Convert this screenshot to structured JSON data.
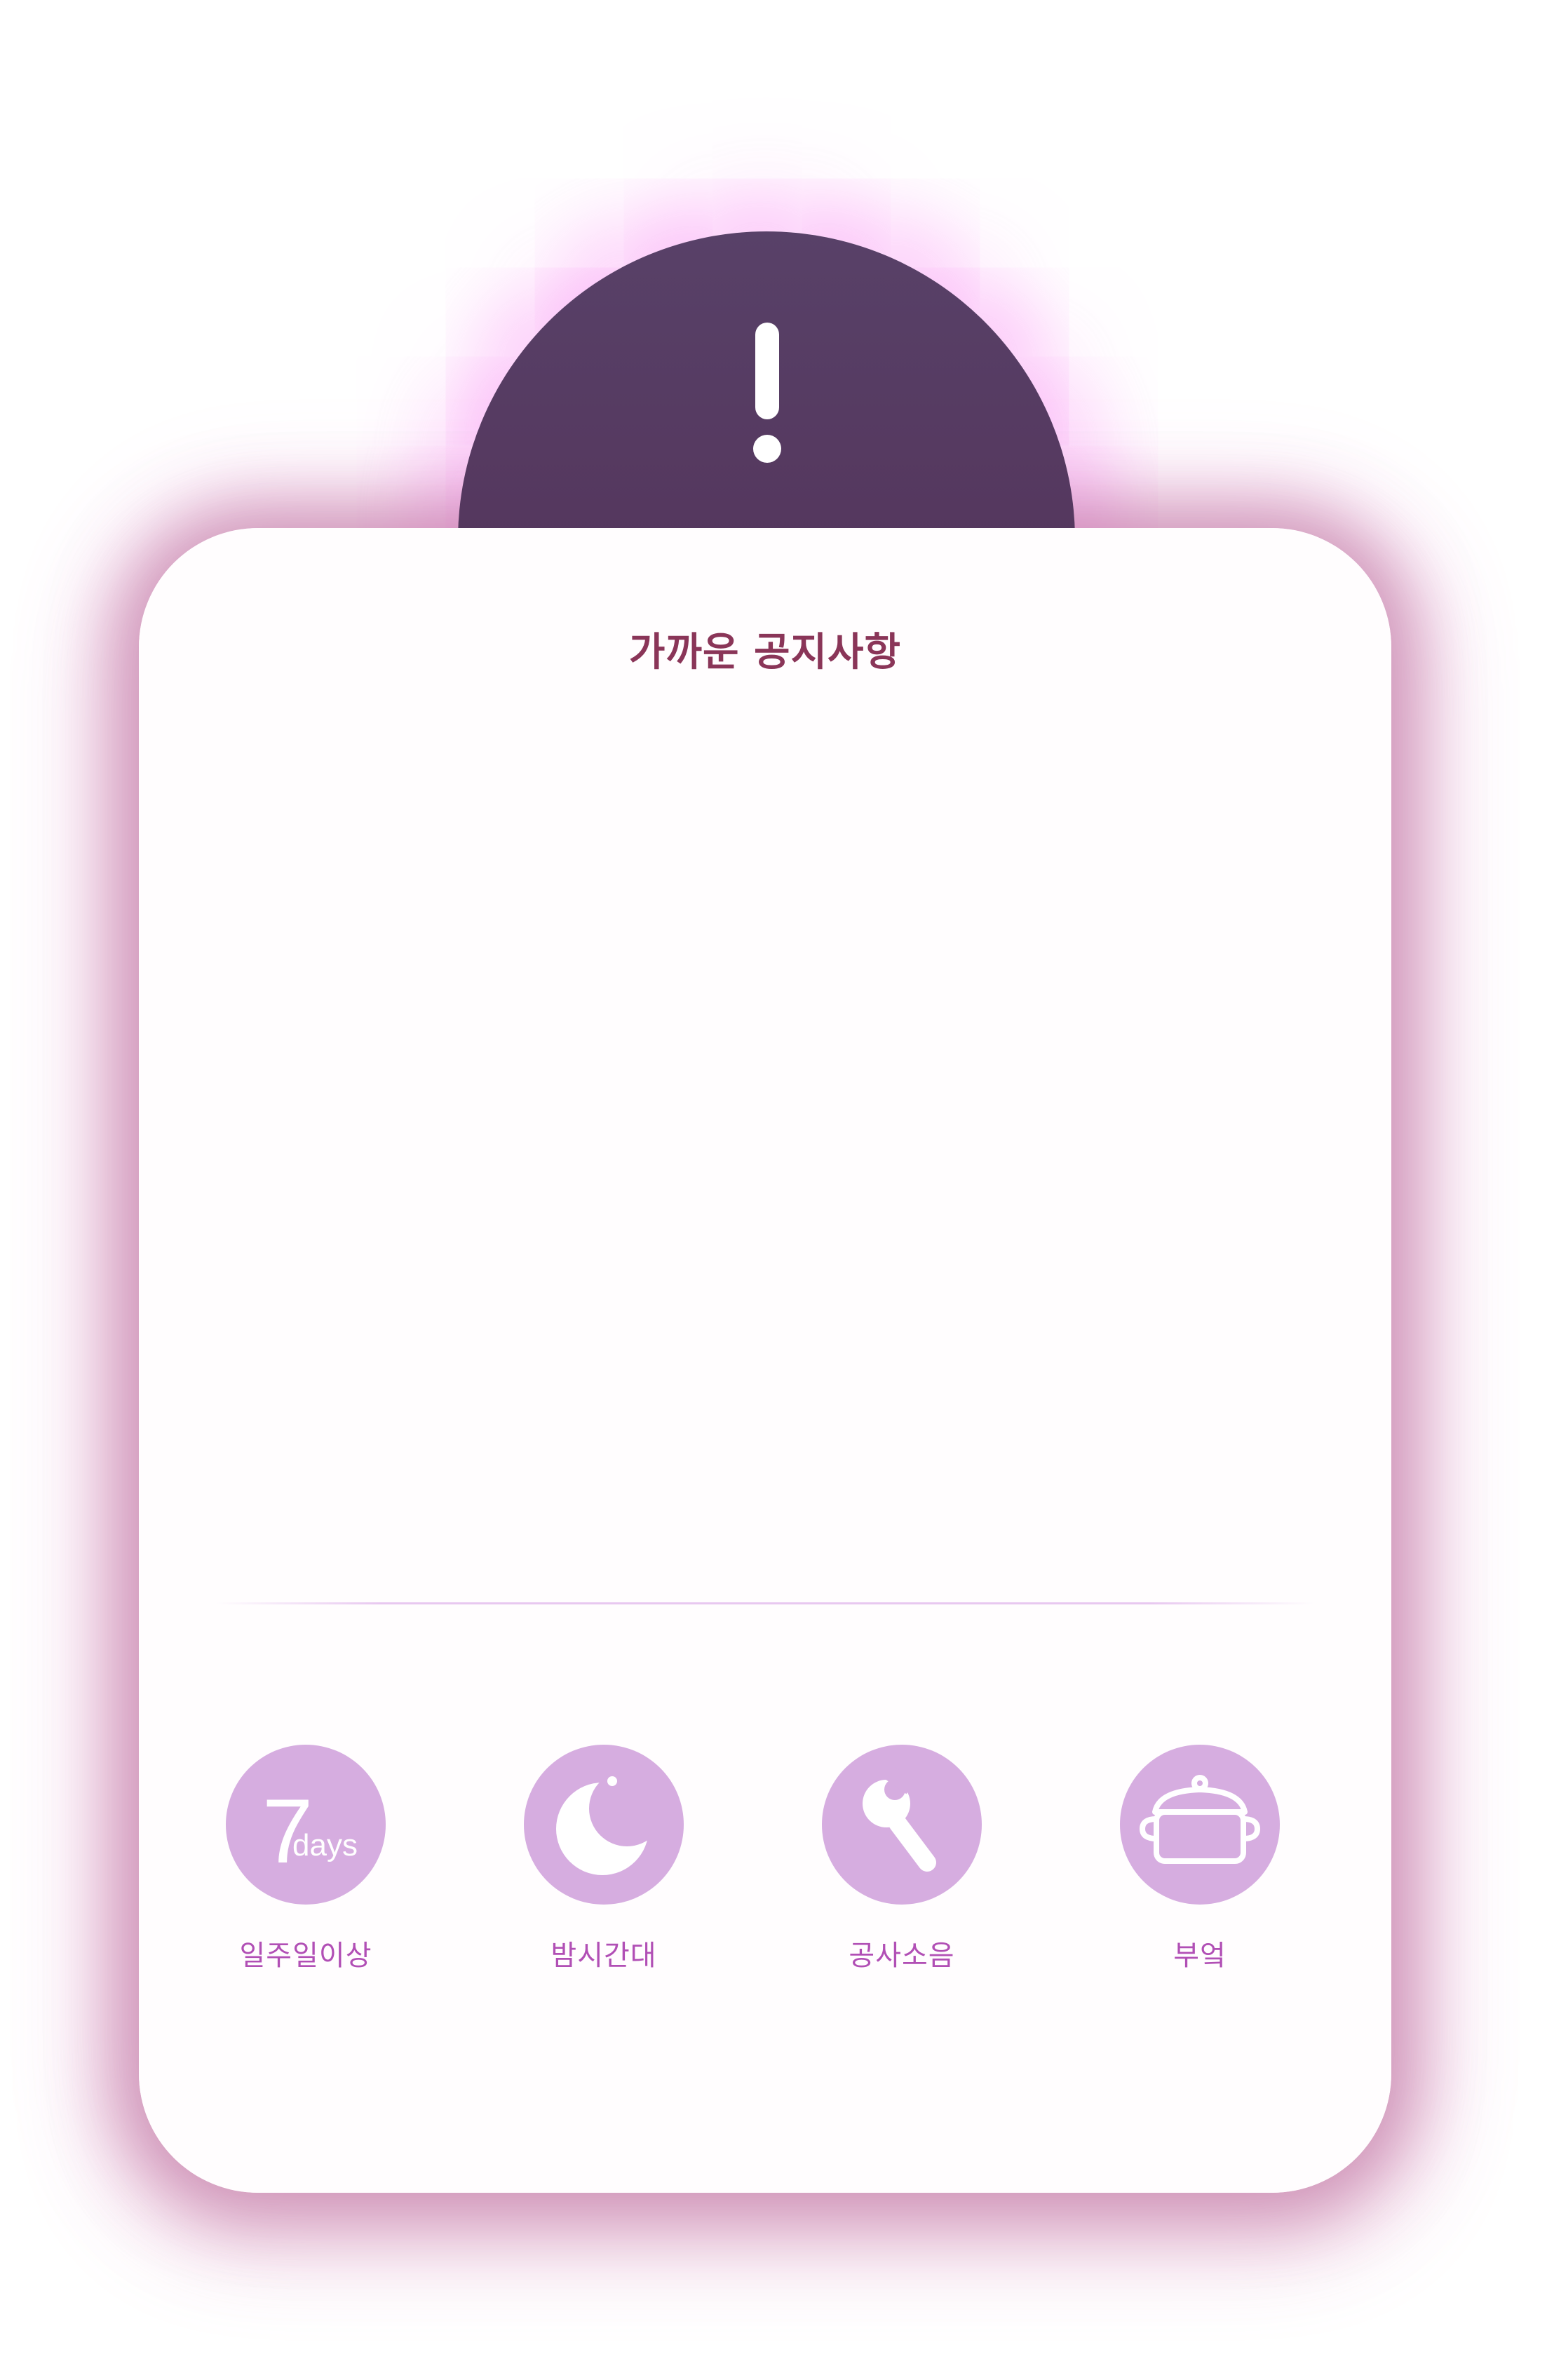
{
  "notice": {
    "title": "가까운 공지사항"
  },
  "categories": [
    {
      "label": "일주일이상",
      "icon": "7-days-icon",
      "icon_number": "7",
      "icon_text": "days"
    },
    {
      "label": "밤시간대",
      "icon": "moon-icon"
    },
    {
      "label": "공사소음",
      "icon": "wrench-icon"
    },
    {
      "label": "부엌",
      "icon": "cooking-pot-icon"
    }
  ],
  "colors": {
    "dome": "#55385f",
    "title": "#8a3558",
    "icon_circle": "#d6ade0",
    "label": "#b14fb5",
    "glow": "#f778f0"
  }
}
